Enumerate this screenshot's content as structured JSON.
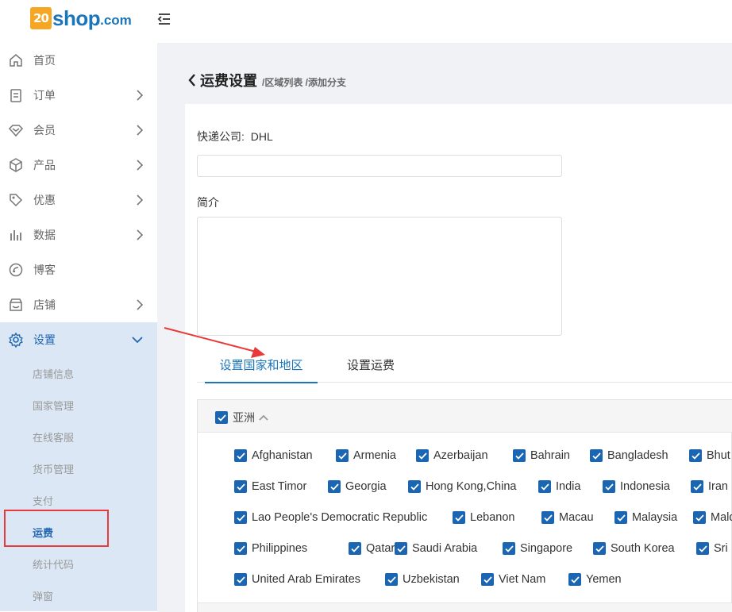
{
  "brand": {
    "badge": "20",
    "name": "shop",
    "suffix": ".com",
    "badge_color": "#f5a623",
    "name_color": "#1b75bb"
  },
  "sidebar": {
    "items": [
      {
        "label": "首页",
        "icon": "home-icon",
        "chevron": "none"
      },
      {
        "label": "订单",
        "icon": "order-icon",
        "chevron": "right"
      },
      {
        "label": "会员",
        "icon": "member-icon",
        "chevron": "right"
      },
      {
        "label": "产品",
        "icon": "product-box-icon",
        "chevron": "right"
      },
      {
        "label": "优惠",
        "icon": "tag-icon",
        "chevron": "right"
      },
      {
        "label": "数据",
        "icon": "bar-chart-icon",
        "chevron": "right"
      },
      {
        "label": "博客",
        "icon": "blog-icon",
        "chevron": "none"
      },
      {
        "label": "店铺",
        "icon": "store-icon",
        "chevron": "right"
      },
      {
        "label": "设置",
        "icon": "gear-icon",
        "chevron": "down"
      }
    ],
    "settings_sub": [
      "店铺信息",
      "国家管理",
      "在线客服",
      "货币管理",
      "支付",
      "运费",
      "统计代码",
      "弹窗"
    ],
    "current_sub": "运费"
  },
  "header": {
    "title": "运费设置",
    "breadcrumb": "/区域列表 /添加分支"
  },
  "form": {
    "company_label": "快递公司:",
    "company_value": "DHL",
    "name_value": "",
    "intro_label": "简介",
    "intro_value": ""
  },
  "tabs": [
    {
      "label": "设置国家和地区",
      "active": true
    },
    {
      "label": "设置运费",
      "active": false
    }
  ],
  "region": {
    "name": "亚洲",
    "checked": true,
    "rows": [
      [
        "Afghanistan",
        "Armenia",
        "Azerbaijan",
        "Bahrain",
        "Bangladesh",
        "Bhut"
      ],
      [
        "East Timor",
        "Georgia",
        "Hong Kong,China",
        "India",
        "Indonesia",
        "Iran"
      ],
      [
        "Lao People's Democratic Republic",
        "Lebanon",
        "Macau",
        "Malaysia",
        "Mald"
      ],
      [
        "Philippines",
        "Qatar",
        "Saudi Arabia",
        "Singapore",
        "South Korea",
        "Sri"
      ],
      [
        "United Arab Emirates",
        "Uzbekistan",
        "Viet Nam",
        "Yemen"
      ]
    ]
  },
  "colors": {
    "accent": "#1b75bb",
    "checkbox": "#1b66b3",
    "highlight": "#e83a3a",
    "sidebar_active": "#dbe7f5"
  }
}
